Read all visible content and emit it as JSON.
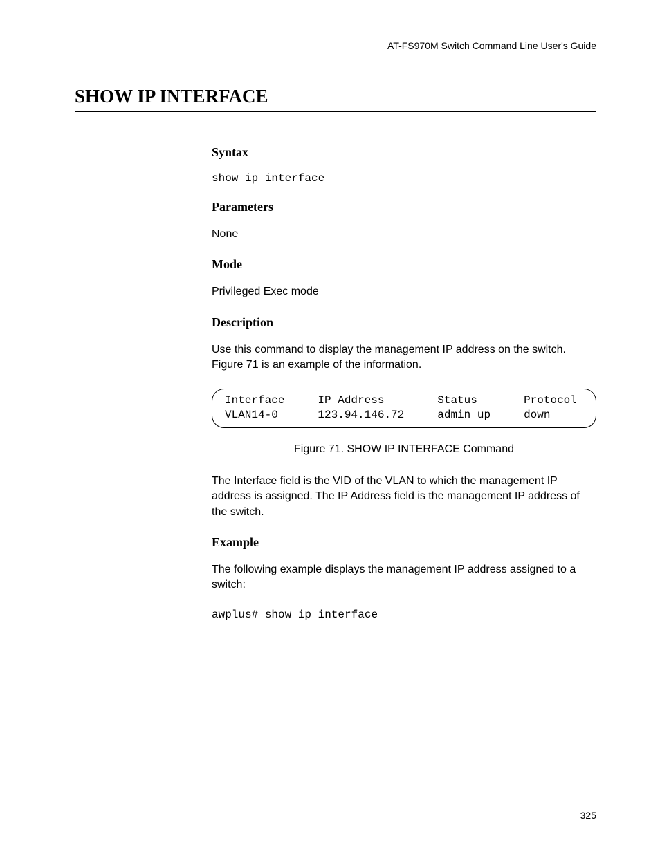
{
  "header": {
    "guide_title": "AT-FS970M Switch Command Line User's Guide"
  },
  "title": "SHOW IP INTERFACE",
  "sections": {
    "syntax": {
      "heading": "Syntax",
      "command": "show ip interface"
    },
    "parameters": {
      "heading": "Parameters",
      "text": "None"
    },
    "mode": {
      "heading": "Mode",
      "text": "Privileged Exec mode"
    },
    "description": {
      "heading": "Description",
      "intro": "Use this command to display the management IP address on the switch. Figure 71 is an example of the information.",
      "figure": {
        "header_row": "Interface     IP Address        Status       Protocol",
        "data_row": "VLAN14-0      123.94.146.72     admin up     down",
        "caption": "Figure 71. SHOW IP INTERFACE Command"
      },
      "post_text": "The Interface field is the VID of the VLAN to which the management IP address is assigned. The IP Address field is the management IP address of the switch."
    },
    "example": {
      "heading": "Example",
      "intro": "The following example displays the management IP address assigned to a switch:",
      "command": "awplus# show ip interface"
    }
  },
  "page_number": "325"
}
